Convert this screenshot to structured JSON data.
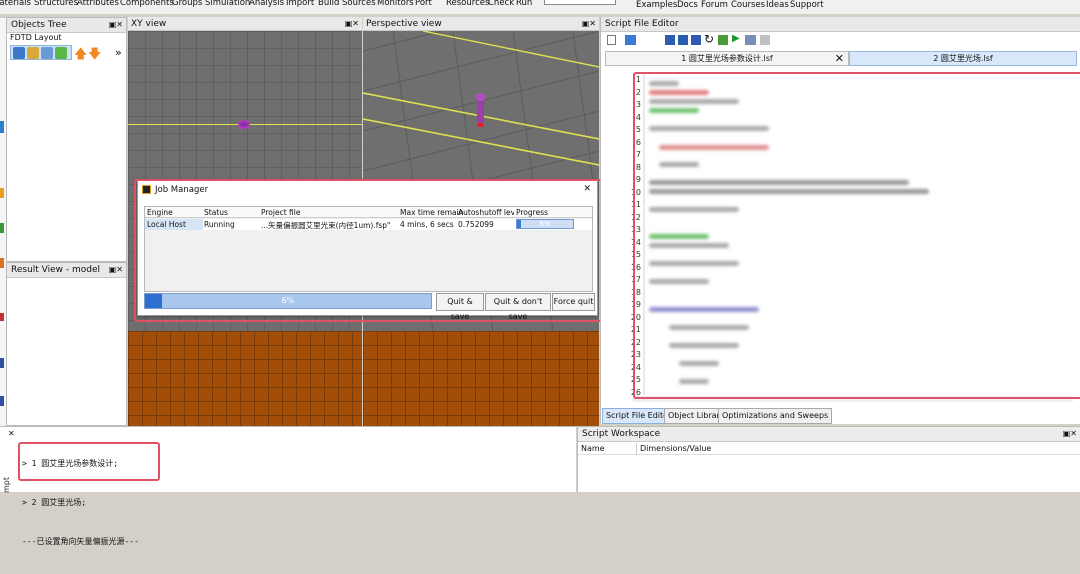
{
  "menubar": {
    "items": [
      "Materials",
      "Structures",
      "Attributes",
      "Components",
      "Groups",
      "Simulation",
      "Analysis",
      "Import",
      "Build",
      "Sources",
      "Monitors",
      "Port",
      "Resources",
      "Check",
      "Run"
    ],
    "right_items": [
      "Examples",
      "Docs",
      "Forum",
      "Courses",
      "Ideas",
      "Support"
    ]
  },
  "objects_tree": {
    "title": "Objects Tree",
    "root": "FDTD Layout",
    "more": "»"
  },
  "result_view": {
    "title": "Result View - model"
  },
  "views": {
    "xy": "XY view",
    "perspective": "Perspective view"
  },
  "job_manager": {
    "title": "Job Manager",
    "close": "✕",
    "columns": [
      "Engine",
      "Status",
      "Project file",
      "Max time remain",
      "Autoshutoff leve",
      "Progress"
    ],
    "rows": [
      {
        "engine": "Local Host",
        "status": "Running",
        "project": "...矢量偏振圆艾里光束(内径1um).fsp\"",
        "time": "4 mins, 6 secs",
        "autoshutoff": "0.752099",
        "progress": "6%"
      }
    ],
    "overall_progress": "6%",
    "overall_fraction": 0.06,
    "buttons": {
      "quit_save": "Quit & save",
      "quit_dont_save": "Quit & don't save",
      "force_quit": "Force quit"
    }
  },
  "script_editor": {
    "title": "Script File Editor",
    "tabs": [
      "1 圆艾里光场参数设计.lsf",
      "2 圆艾里光场.lsf"
    ],
    "tab_close": "✕",
    "line_numbers": [
      "1",
      "2",
      "3",
      "4",
      "5",
      "6",
      "7",
      "8",
      "9",
      "10",
      "11",
      "12",
      "13",
      "14",
      "15",
      "16",
      "17",
      "18",
      "19",
      "20",
      "21",
      "22",
      "23",
      "24",
      "25",
      "26"
    ],
    "bottom_tabs": [
      "Script File Editor",
      "Object Library",
      "Optimizations and Sweeps"
    ]
  },
  "console": {
    "lines": [
      "> 1 圆艾里光场参数设计;",
      "> 2 圆艾里光场;",
      "---已设置角向矢量偏振光源---"
    ],
    "side_label": "mpt"
  },
  "workspace": {
    "title": "Script Workspace",
    "columns": [
      "Name",
      "Dimensions/Value"
    ]
  },
  "colors": {
    "accent": "#e05066",
    "substrate": "#a24e08",
    "grid": "#6e6e6e",
    "progress": "#7ba7e0"
  }
}
